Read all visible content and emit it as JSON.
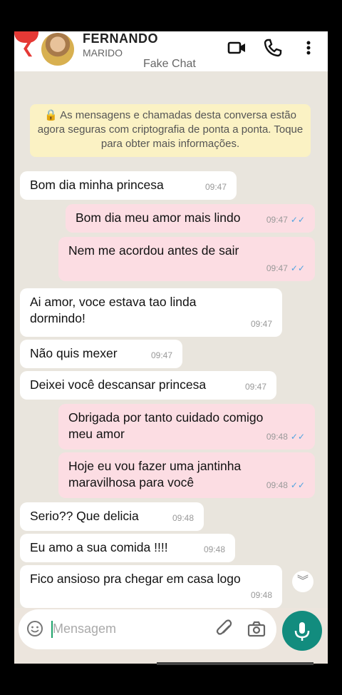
{
  "header": {
    "name": "FERNANDO",
    "subtitle": "MARIDO",
    "title": "Fake Chat"
  },
  "encryption_notice": "🔒 As mensagens e chamadas desta conversa estão agora seguras com criptografia de ponta a ponta. Toque para obter mais informações.",
  "messages": [
    {
      "dir": "in",
      "text": "Bom dia minha princesa",
      "time": "09:47"
    },
    {
      "dir": "out",
      "text": "Bom dia meu amor mais lindo",
      "time": "09:47"
    },
    {
      "dir": "out",
      "text": "Nem me acordou antes de sair",
      "time": "09:47"
    },
    {
      "dir": "in",
      "text": "Ai amor, voce estava tao linda dormindo!",
      "time": "09:47"
    },
    {
      "dir": "in",
      "text": "Não quis mexer",
      "time": "09:47"
    },
    {
      "dir": "in",
      "text": "Deixei você descansar princesa",
      "time": "09:47"
    },
    {
      "dir": "out",
      "text": "Obrigada por tanto cuidado comigo meu amor",
      "time": "09:48"
    },
    {
      "dir": "out",
      "text": "Hoje eu vou fazer uma jantinha maravilhosa para você",
      "time": "09:48"
    },
    {
      "dir": "in",
      "text": "Serio?? Que delicia",
      "time": "09:48"
    },
    {
      "dir": "in",
      "text": "Eu amo a sua comida !!!!",
      "time": "09:48"
    },
    {
      "dir": "in",
      "text": "Fico ansioso pra chegar em casa logo",
      "time": "09:48"
    }
  ],
  "input": {
    "placeholder": "Mensagem"
  },
  "icons": {
    "video": "video-call-icon",
    "call": "phone-icon",
    "menu": "more-vert-icon",
    "emoji": "emoji-icon",
    "attach": "paperclip-icon",
    "camera": "camera-icon",
    "mic": "mic-icon",
    "scroll": "chevron-double-down-icon",
    "lock": "lock-icon"
  },
  "colors": {
    "accent": "#128c7e",
    "outgoing": "#fcdde3",
    "incoming": "#ffffff",
    "notice": "#fbf2c4",
    "ticks": "#4fa3e0"
  }
}
